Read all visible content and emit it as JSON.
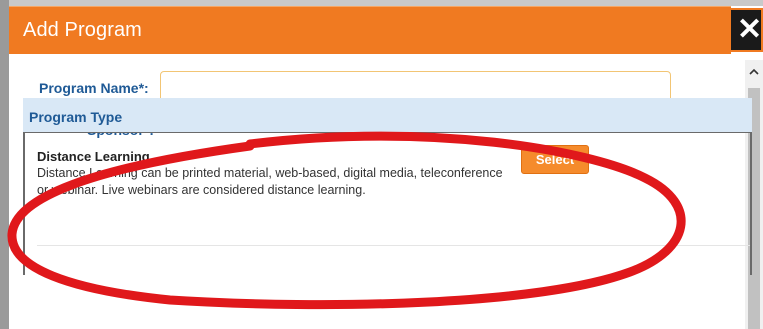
{
  "dialog": {
    "title": "Add Program",
    "close_icon": "close-icon",
    "close_glyph": "✕"
  },
  "form": {
    "program_name_label": "Program Name*:",
    "program_name_value": "",
    "sponsor_label": "Sponsor*:"
  },
  "program_type": {
    "header": "Program Type",
    "items": [
      {
        "title": "Distance Learning",
        "description": "Distance Learning can be printed material, web-based, digital media, teleconference or webinar. Live webinars are considered distance learning.",
        "select_label": "Select"
      }
    ]
  },
  "colors": {
    "header_bg": "#f07a21",
    "label_blue": "#1f5a96",
    "section_bg": "#d9e8f6",
    "button_orange": "#f58b2c",
    "annotation_red": "#e0181b"
  }
}
